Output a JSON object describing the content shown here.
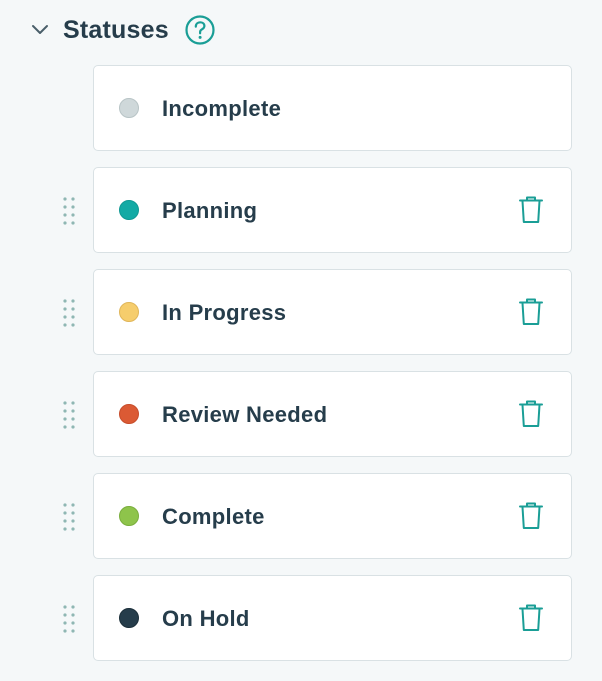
{
  "section": {
    "title": "Statuses",
    "collapse_icon": "chevron-down-icon",
    "help_icon": "help-circle-icon"
  },
  "colors": {
    "accent": "#1a9e96",
    "title_text": "#263d4b",
    "card_border": "#d9e1e4",
    "page_background": "#f5f8f9"
  },
  "statuses": [
    {
      "label": "Incomplete",
      "color": "#cfd8da",
      "border": "#b8c4c6",
      "draggable": false,
      "deletable": false
    },
    {
      "label": "Planning",
      "color": "#12aaa5",
      "border": "#0f9994",
      "draggable": true,
      "deletable": true
    },
    {
      "label": "In Progress",
      "color": "#f6cd6c",
      "border": "#e0b65a",
      "draggable": true,
      "deletable": true
    },
    {
      "label": "Review Needed",
      "color": "#db5a34",
      "border": "#c74d2b",
      "draggable": true,
      "deletable": true
    },
    {
      "label": "Complete",
      "color": "#8ec44b",
      "border": "#7aae3d",
      "draggable": true,
      "deletable": true
    },
    {
      "label": "On Hold",
      "color": "#263d4b",
      "border": "#1c2f3a",
      "draggable": true,
      "deletable": true
    }
  ],
  "row_icons": {
    "drag": "drag-handle-icon",
    "delete": "trash-icon"
  }
}
